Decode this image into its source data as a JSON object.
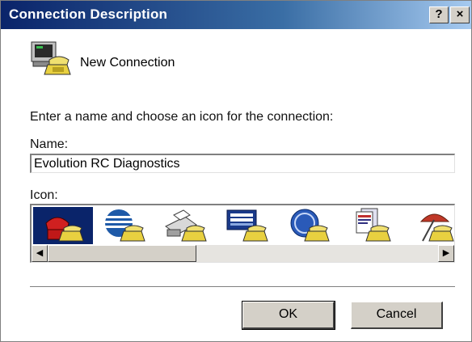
{
  "window": {
    "title": "Connection Description",
    "help_label": "?",
    "close_label": "×"
  },
  "connection": {
    "name_display": "New Connection",
    "icon": "telephone-computer-icon"
  },
  "form": {
    "instruction": "Enter a name and choose an icon for the connection:",
    "name_label": "Name:",
    "name_value": "Evolution RC Diagnostics",
    "icon_label": "Icon:"
  },
  "icon_list": {
    "items": [
      {
        "name": "red-phone-icon",
        "selected": true
      },
      {
        "name": "globe-phone-icon",
        "selected": false
      },
      {
        "name": "fax-phone-icon",
        "selected": false
      },
      {
        "name": "mci-phone-icon",
        "selected": false
      },
      {
        "name": "ge-phone-icon",
        "selected": false
      },
      {
        "name": "documents-phone-icon",
        "selected": false
      },
      {
        "name": "umbrella-phone-icon",
        "selected": false
      }
    ],
    "scroll_position": 0
  },
  "buttons": {
    "ok": "OK",
    "cancel": "Cancel"
  },
  "colors": {
    "titlebar_start": "#0a246a",
    "titlebar_end": "#a6caf0",
    "selection": "#0a246a",
    "face": "#d4d0c8"
  }
}
